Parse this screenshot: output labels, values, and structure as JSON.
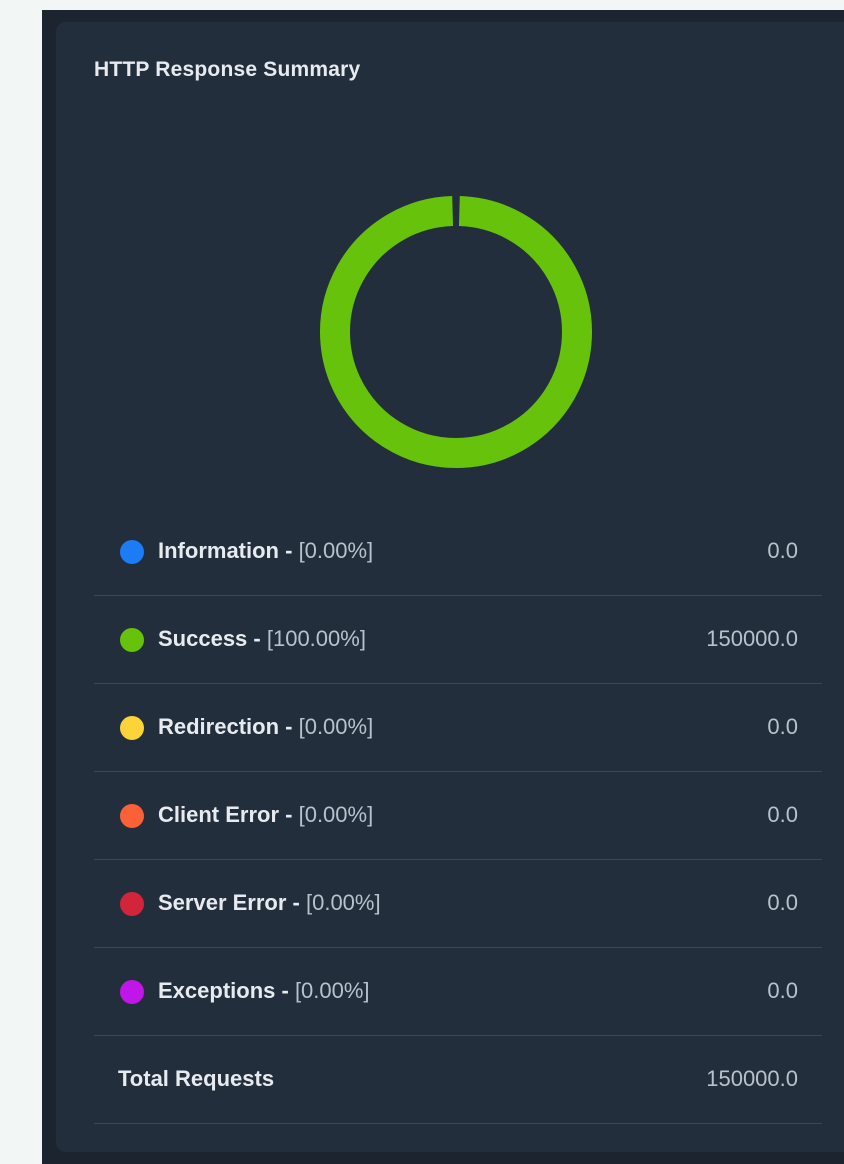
{
  "card": {
    "title": "HTTP Response Summary"
  },
  "chart_data": {
    "type": "pie",
    "style": "donut",
    "categories": [
      "Information",
      "Success",
      "Redirection",
      "Client Error",
      "Server Error",
      "Exceptions"
    ],
    "values": [
      0.0,
      150000.0,
      0.0,
      0.0,
      0.0,
      0.0
    ],
    "colors": [
      "#1b7cf5",
      "#66c20a",
      "#fdd33a",
      "#fb6137",
      "#d2243a",
      "#c116e8"
    ]
  },
  "legend": {
    "separator": " - ",
    "items": [
      {
        "name": "Information",
        "percent": "[0.00%]",
        "value": "0.0",
        "color": "#1b7cf5"
      },
      {
        "name": "Success",
        "percent": "[100.00%]",
        "value": "150000.0",
        "color": "#66c20a"
      },
      {
        "name": "Redirection",
        "percent": "[0.00%]",
        "value": "0.0",
        "color": "#fdd33a"
      },
      {
        "name": "Client Error",
        "percent": "[0.00%]",
        "value": "0.0",
        "color": "#fb6137"
      },
      {
        "name": "Server Error",
        "percent": "[0.00%]",
        "value": "0.0",
        "color": "#d2243a"
      },
      {
        "name": "Exceptions",
        "percent": "[0.00%]",
        "value": "0.0",
        "color": "#c116e8"
      }
    ]
  },
  "total": {
    "label": "Total Requests",
    "value": "150000.0"
  }
}
